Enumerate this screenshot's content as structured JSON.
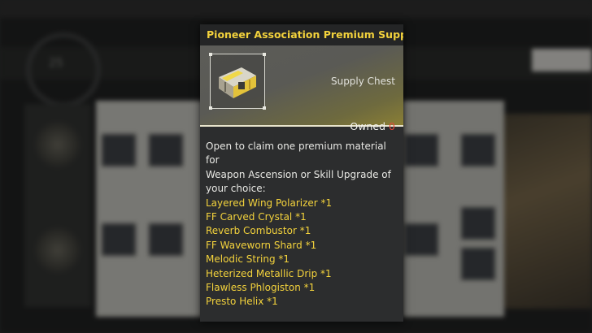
{
  "tooltip": {
    "title": "Pioneer Association Premium Supply II",
    "item_type": "Supply Chest",
    "owned_label": "Owned",
    "owned_count": "0",
    "icon": "supply-chest-icon",
    "description": [
      "Open to claim one premium material for",
      "Weapon Ascension or Skill Upgrade of",
      "your choice:"
    ],
    "rewards": [
      "Layered Wing Polarizer *1",
      "FF Carved Crystal *1",
      "Reverb Combustor *1",
      "FF Waveworn Shard *1",
      "Melodic String *1",
      "Heterized Metallic Drip *1",
      "Flawless Phlogiston *1",
      "Presto Helix *1"
    ]
  },
  "background": {
    "ring_value": "25"
  },
  "colors": {
    "title": "#f3d23c",
    "reward_text": "#f3d23c",
    "owned_zero": "#e2473a",
    "panel": "#2c2d2e"
  }
}
